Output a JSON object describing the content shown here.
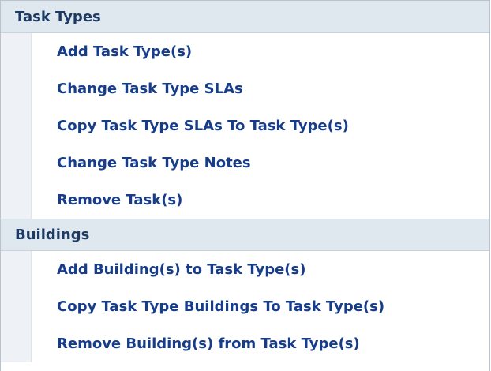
{
  "sections": [
    {
      "title": "Task Types",
      "items": [
        {
          "label": "Add Task Type(s)"
        },
        {
          "label": "Change Task Type SLAs"
        },
        {
          "label": "Copy Task Type SLAs To Task Type(s)"
        },
        {
          "label": "Change Task Type Notes"
        },
        {
          "label": "Remove Task(s)"
        }
      ]
    },
    {
      "title": "Buildings",
      "items": [
        {
          "label": "Add Building(s) to Task Type(s)"
        },
        {
          "label": "Copy Task Type Buildings To Task Type(s)"
        },
        {
          "label": "Remove Building(s) from Task Type(s)"
        }
      ]
    }
  ]
}
